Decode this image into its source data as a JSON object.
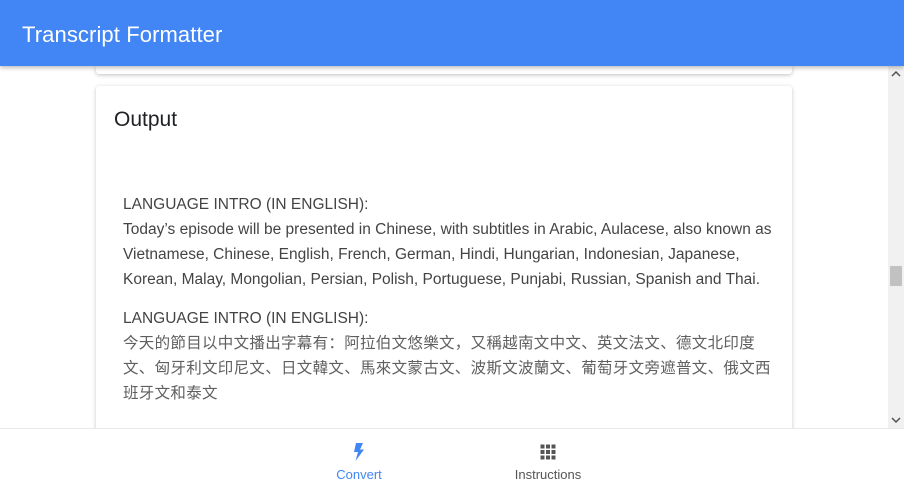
{
  "app": {
    "title": "Transcript Formatter"
  },
  "output": {
    "title": "Output",
    "sections": [
      {
        "heading": "LANGUAGE INTRO (IN ENGLISH):",
        "body": "Today’s episode will be presented in Chinese, with subtitles in Arabic, Aulacese, also known as Vietnamese, Chinese, English, French, German, Hindi, Hungarian, Indonesian, Japanese, Korean, Malay, Mongolian, Persian, Polish, Portuguese, Punjabi, Russian, Spanish and Thai."
      },
      {
        "heading": "LANGUAGE INTRO (IN ENGLISH):",
        "body": "今天的節目以中文播出字幕有：阿拉伯文悠樂文，又稱越南文中文、英文法文、德文北印度文、匈牙利文印尼文、日文韓文、馬來文蒙古文、波斯文波蘭文、葡萄牙文旁遮普文、俄文西班牙文和泰文"
      }
    ]
  },
  "bottom_nav": {
    "items": [
      {
        "label": "Convert",
        "icon": "bolt-icon",
        "active": true
      },
      {
        "label": "Instructions",
        "icon": "grid-icon",
        "active": false
      }
    ]
  },
  "colors": {
    "primary": "#4285f4",
    "inactive": "#555555"
  }
}
